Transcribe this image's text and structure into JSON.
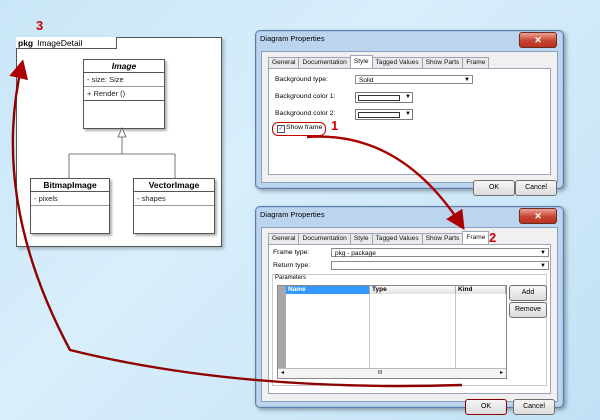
{
  "uml": {
    "package_keyword": "pkg",
    "package_name": "ImageDetail",
    "base_class": {
      "name": "Image",
      "attribute": "- size: Size",
      "operation": "+ Render ()"
    },
    "subclasses": [
      {
        "name": "BitmapImage",
        "attribute": "- pixels"
      },
      {
        "name": "VectorImage",
        "attribute": "- shapes"
      }
    ]
  },
  "callouts": [
    "1",
    "2",
    "3"
  ],
  "dialog_top": {
    "title": "Diagram Properties",
    "close_glyph": "✕",
    "tabs": [
      "General",
      "Documentation",
      "Style",
      "Tagged Values",
      "Show Parts",
      "Frame"
    ],
    "selected_tab": "Style",
    "fields": {
      "background_type_label": "Background type:",
      "background_type_value": "Solid",
      "background_color1_label": "Background color 1:",
      "background_color2_label": "Background color 2:",
      "show_frame_label": "Show frame",
      "show_frame_checked": true,
      "checkbox_glyph": "✓"
    },
    "ok": "OK",
    "cancel": "Cancel"
  },
  "dialog_bottom": {
    "title": "Diagram Properties",
    "close_glyph": "✕",
    "tabs": [
      "General",
      "Documentation",
      "Style",
      "Tagged Values",
      "Show Parts",
      "Frame"
    ],
    "selected_tab": "Frame",
    "fields": {
      "frame_type_label": "Frame type:",
      "frame_type_value": "pkg - package",
      "return_type_label": "Return type:",
      "return_type_value": "",
      "parameters_label": "Parameters"
    },
    "grid_columns": [
      "Name",
      "Type",
      "Kind"
    ],
    "scroll_marker": "III",
    "add": "Add",
    "remove": "Remove",
    "ok": "OK",
    "cancel": "Cancel"
  },
  "colors": {
    "accent_red": "#c00000",
    "arrow_red": "#aa0000",
    "dialog_border": "#5d7ea7",
    "highlight_blue": "#3399ff"
  },
  "icons": [
    "close-icon",
    "dropdown-arrow-icon",
    "checkbox-checked-icon",
    "left-arrow-icon",
    "right-arrow-icon",
    "generalization-arrow-icon"
  ]
}
